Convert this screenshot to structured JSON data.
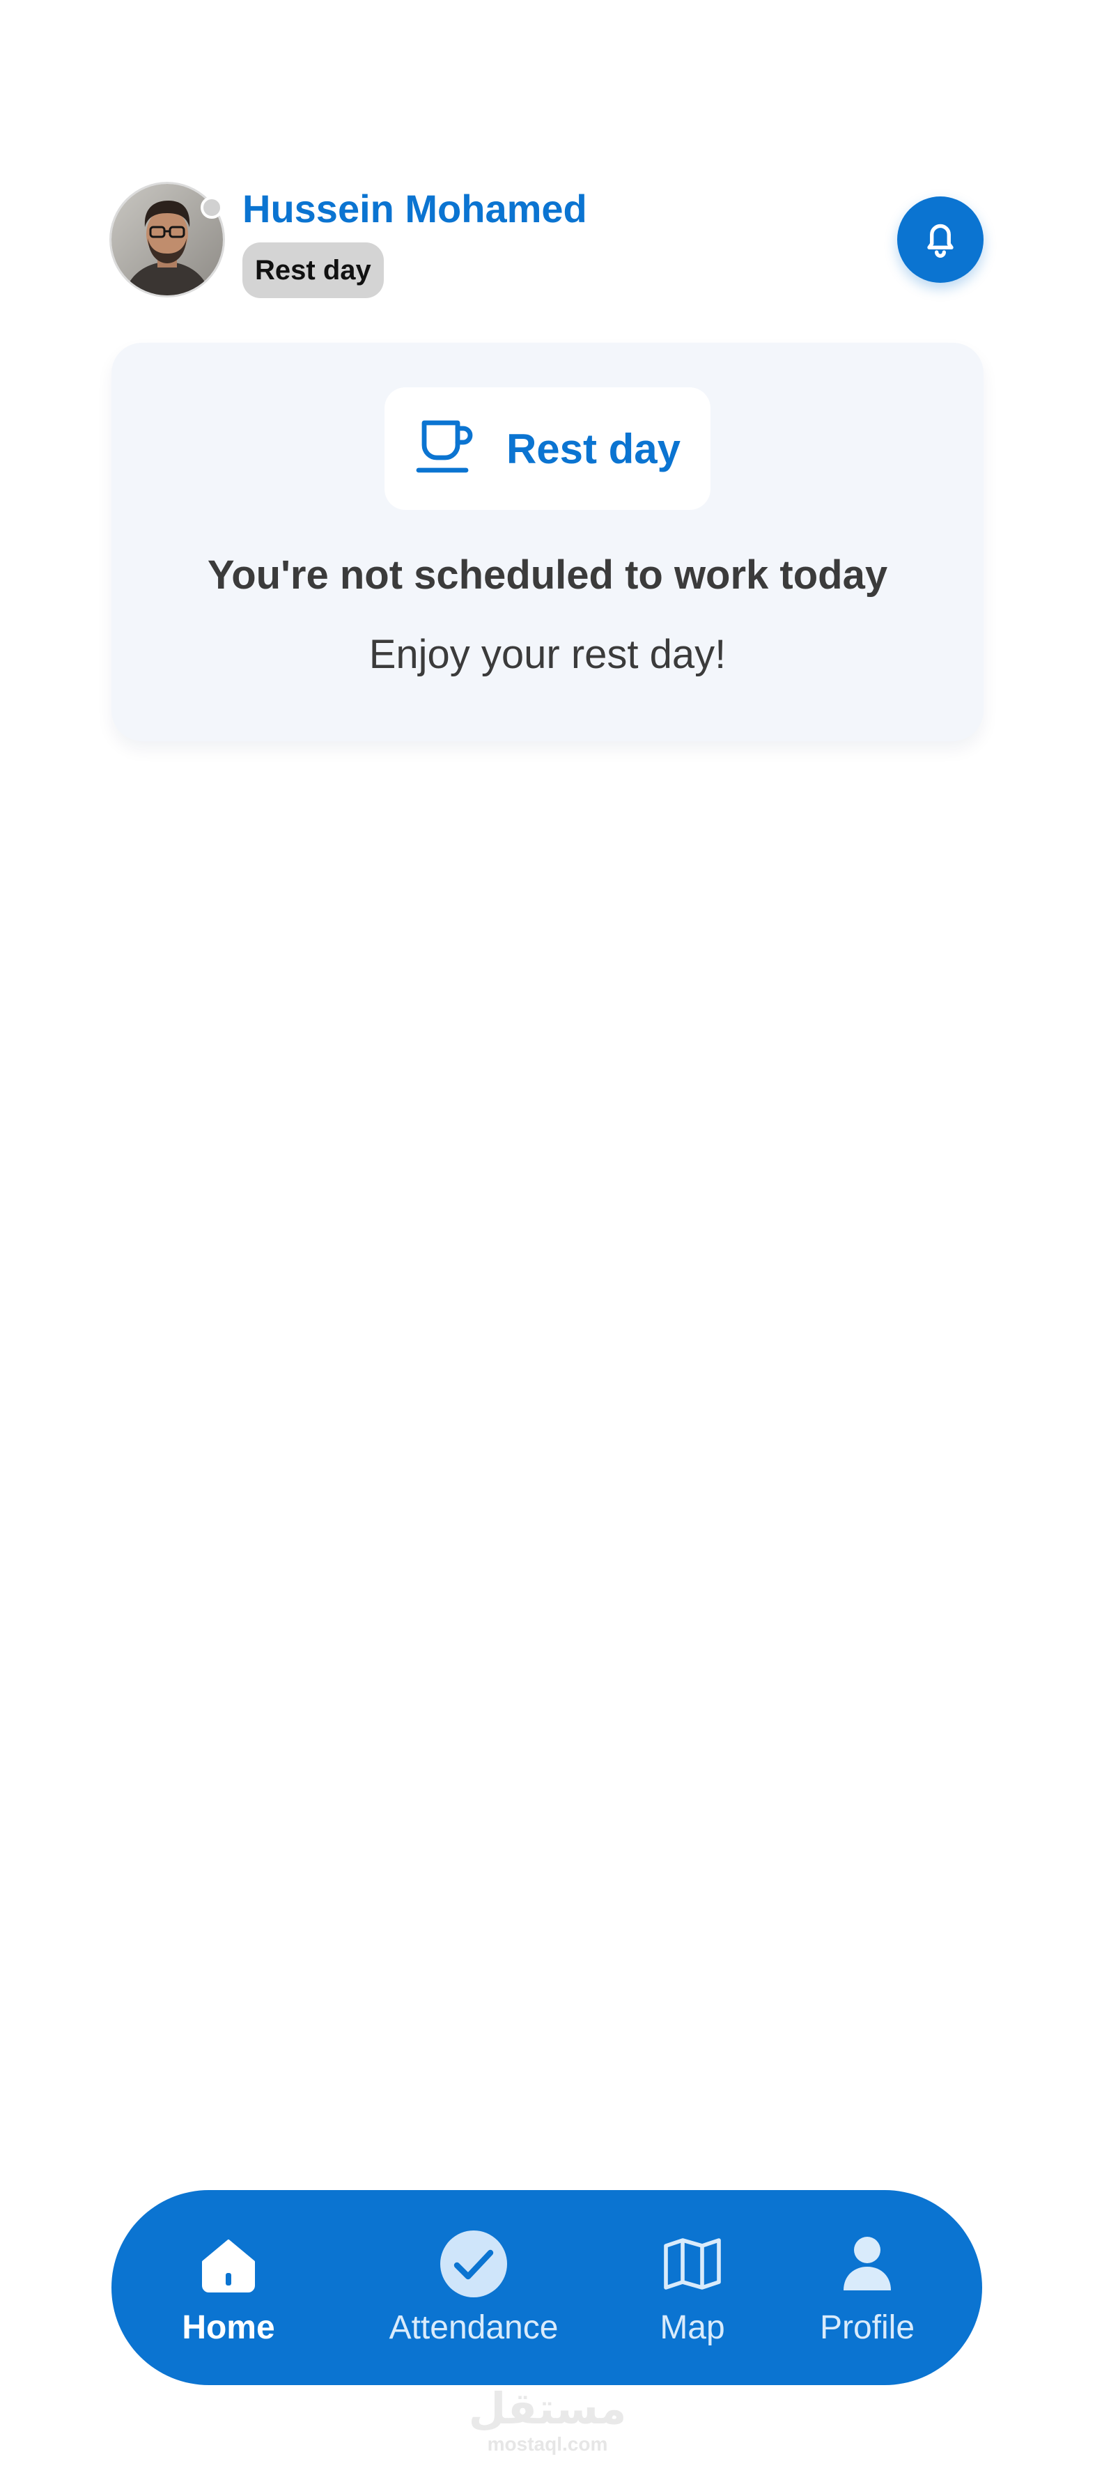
{
  "header": {
    "user_name": "Hussein Mohamed",
    "status_label": "Rest day",
    "avatar": "user-photo",
    "notification_icon": "bell-icon"
  },
  "rest_card": {
    "chip_icon": "coffee-cup-icon",
    "chip_label": "Rest day",
    "title": "You're not scheduled to work today",
    "subtitle": "Enjoy your rest day!"
  },
  "bottom_nav": {
    "items": [
      {
        "label": "Home",
        "icon": "home-icon",
        "active": true
      },
      {
        "label": "Attendance",
        "icon": "check-circle-icon",
        "active": false
      },
      {
        "label": "Map",
        "icon": "map-icon",
        "active": false
      },
      {
        "label": "Profile",
        "icon": "user-icon",
        "active": false
      }
    ]
  },
  "watermark": {
    "arabic": "مستقل",
    "site": "mostaql.com"
  },
  "colors": {
    "primary": "#0b74d1",
    "card_background": "#f3f6fb",
    "status_pill": "#d4d4d4",
    "text_dark": "#3b3b3b"
  }
}
